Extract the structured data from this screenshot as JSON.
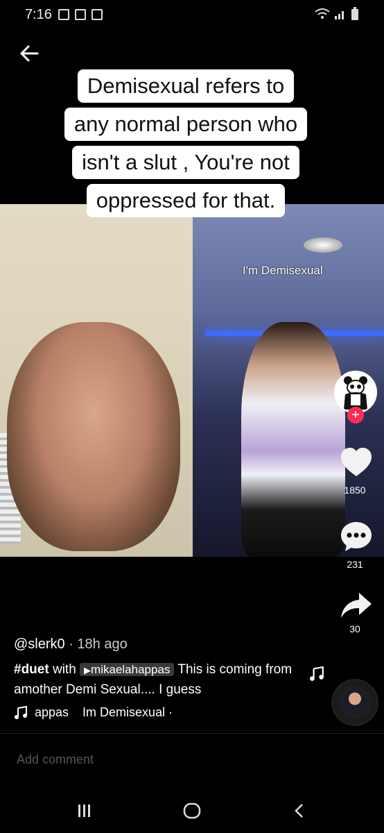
{
  "status_bar": {
    "time": "7:16"
  },
  "caption": {
    "lines": [
      "Demisexual refers to",
      "any normal person who",
      "isn't a slut , You're not",
      "oppressed for that."
    ]
  },
  "video": {
    "overlay_text": "I'm Demisexual"
  },
  "rail": {
    "likes": "1850",
    "comments": "231",
    "shares": "30"
  },
  "post": {
    "username": "@slerk0",
    "time_ago": " · 18h ago",
    "hashtag": "#duet",
    "with_word": " with ",
    "mention": "mikaelahappas",
    "desc_rest": " This is coming from amother Demi Sexual.... I guess"
  },
  "music": {
    "artist_fragment": "appas",
    "title": "Im Demisexual ·"
  },
  "comment": {
    "placeholder": "Add comment"
  },
  "colors": {
    "background": "#000000",
    "accent": "#fe2c55",
    "caption_bg": "#ffffff"
  }
}
